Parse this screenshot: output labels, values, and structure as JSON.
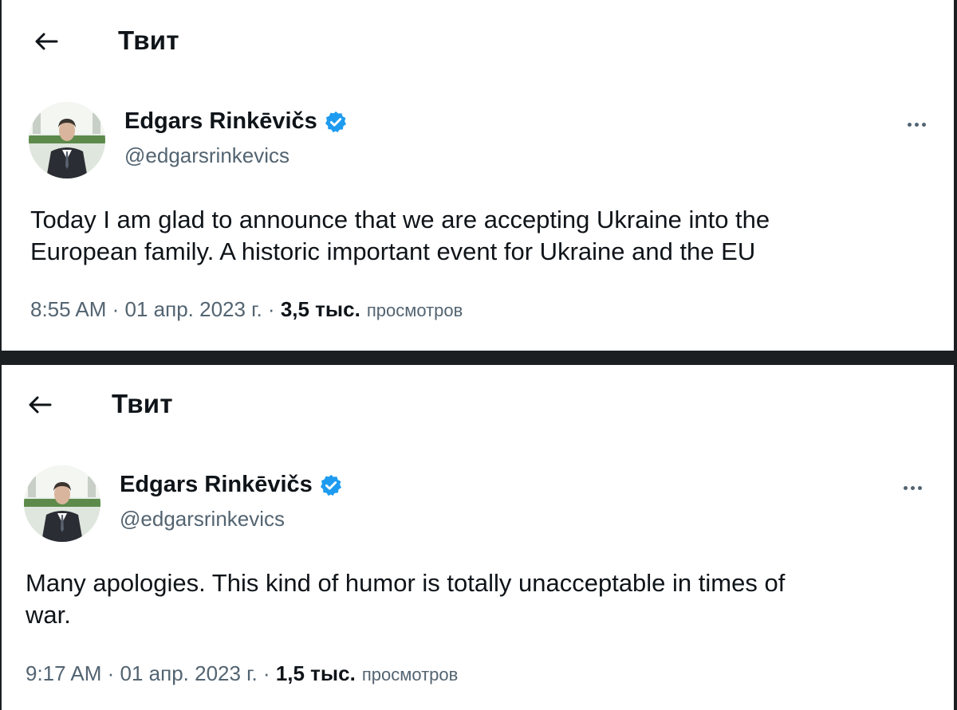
{
  "tweets": [
    {
      "header_title": "Твит",
      "author_name": "Edgars Rinkēvičs",
      "author_handle": "@edgarsrinkevics",
      "text": "Today I am glad to announce that we are accepting Ukraine into the\nEuropean family. A historic important event for Ukraine and the EU",
      "time": "8:55 AM",
      "date": "01 апр. 2023 г.",
      "views_count": "3,5 тыс.",
      "views_label": "просмотров"
    },
    {
      "header_title": "Твит",
      "author_name": "Edgars Rinkēvičs",
      "author_handle": "@edgarsrinkevics",
      "text": "Many apologies. This kind of humor is totally unacceptable in times of\nwar.",
      "time": "9:17 AM",
      "date": "01 апр. 2023 г.",
      "views_count": "1,5 тыс.",
      "views_label": "просмотров"
    }
  ],
  "separator": " · ",
  "icons": {
    "back": "back-arrow-icon",
    "verified": "verified-badge-icon",
    "more": "more-options-icon"
  },
  "colors": {
    "verified_blue": "#1d9bf0",
    "secondary_text": "#536471",
    "primary_text": "#0f1419",
    "divider": "#1c1f22"
  }
}
